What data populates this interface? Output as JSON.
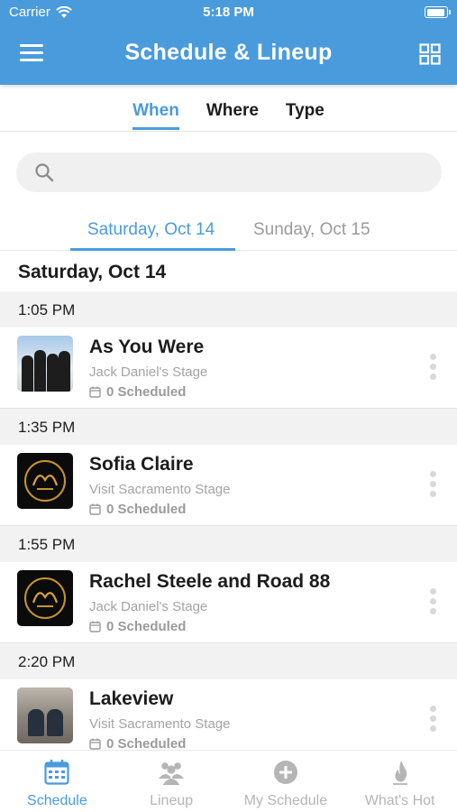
{
  "status_bar": {
    "carrier": "Carrier",
    "time": "5:18 PM"
  },
  "header": {
    "title": "Schedule & Lineup",
    "menu_icon": "hamburger-menu-icon",
    "grid_icon": "grid-view-icon"
  },
  "filter_tabs": [
    {
      "label": "When",
      "active": true
    },
    {
      "label": "Where",
      "active": false
    },
    {
      "label": "Type",
      "active": false
    }
  ],
  "search": {
    "placeholder": "",
    "value": ""
  },
  "day_tabs": [
    {
      "label": "Saturday, Oct 14",
      "active": true
    },
    {
      "label": "Sunday, Oct 15",
      "active": false
    }
  ],
  "date_heading": "Saturday, Oct 14",
  "schedule": [
    {
      "time": "1:05 PM",
      "title": "As You Were",
      "stage": "Jack Daniel's Stage",
      "scheduled": "0 Scheduled"
    },
    {
      "time": "1:35 PM",
      "title": "Sofia Claire",
      "stage": "Visit Sacramento Stage",
      "scheduled": "0 Scheduled"
    },
    {
      "time": "1:55 PM",
      "title": "Rachel Steele and Road 88",
      "stage": "Jack Daniel's Stage",
      "scheduled": "0 Scheduled"
    },
    {
      "time": "2:20 PM",
      "title": "Lakeview",
      "stage": "Visit Sacramento Stage",
      "scheduled": "0 Scheduled"
    }
  ],
  "tab_bar": [
    {
      "label": "Schedule",
      "icon": "calendar-icon",
      "active": true
    },
    {
      "label": "Lineup",
      "icon": "people-icon",
      "active": false
    },
    {
      "label": "My Schedule",
      "icon": "add-circle-icon",
      "active": false
    },
    {
      "label": "What's Hot",
      "icon": "flame-icon",
      "active": false
    }
  ],
  "colors": {
    "accent": "#4a9bdc",
    "header_bg": "#4a9bdc",
    "time_row_bg": "#f2f2f2",
    "muted_text": "#a3a3a3"
  }
}
